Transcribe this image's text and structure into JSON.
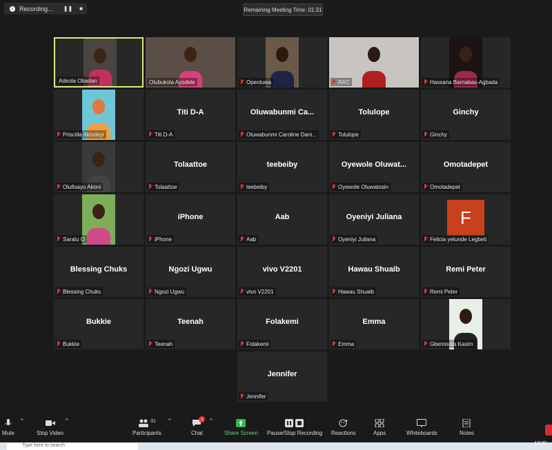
{
  "recording": {
    "label": "Recording...",
    "pause": "❚❚",
    "stop": "■"
  },
  "meeting_timer": "Remaining Meeting Time: 01:31",
  "participants": [
    {
      "big": "",
      "name": "Adeola Obadan",
      "video": true,
      "active": true,
      "bg": "#4a4540",
      "face": "#3a2418",
      "shirt": "#c03060"
    },
    {
      "big": "",
      "name": "Olubukola Ayodele",
      "video": true,
      "bg": "#5a4e47",
      "face": "#3b2415",
      "shirt": "#d8407a"
    },
    {
      "big": "",
      "name": "Opeoluwa",
      "video": true,
      "bg": "#6b5a4a",
      "face": "#2b1a10",
      "shirt": "#224"
    },
    {
      "big": "",
      "name": "RAC",
      "video": true,
      "bg": "#c8c5c0",
      "face": "#2a1a10",
      "shirt": "#b02020"
    },
    {
      "big": "",
      "name": "Hassana Barnabas-Agbada",
      "video": true,
      "bg": "#1c1414",
      "face": "#3a2016",
      "shirt": "#a0284a"
    },
    {
      "big": "",
      "name": "Priscilla Akindeyi",
      "video": true,
      "bg": "#6fc6d6",
      "face": "#e07a3a",
      "shirt": "#f0a040"
    },
    {
      "big": "Titi D-A",
      "name": "Titi D-A"
    },
    {
      "big": "Oluwabunmi  Ca...",
      "name": "Oluwabunmi Caroline Dani..."
    },
    {
      "big": "Tolulope",
      "name": "Tolulope"
    },
    {
      "big": "Ginchy",
      "name": "Ginchy"
    },
    {
      "big": "",
      "name": "Olufisayo Akoni",
      "video": true,
      "bg": "#3a3a3a",
      "face": "#3b2417",
      "shirt": "#444"
    },
    {
      "big": "Tolaattoe",
      "name": "Tolaattoe"
    },
    {
      "big": "teebeiby",
      "name": "teebeiby"
    },
    {
      "big": "Oyewole  Oluwat...",
      "name": "Oyewole Oluwatosin"
    },
    {
      "big": "Omotadepet",
      "name": "Omotadepet"
    },
    {
      "big": "",
      "name": "Saratu O",
      "video": true,
      "bg": "#7fae5a",
      "face": "#3b2416",
      "shirt": "#d04a8a"
    },
    {
      "big": "iPhone",
      "name": "iPhone"
    },
    {
      "big": "Aab",
      "name": "Aab"
    },
    {
      "big": "Oyeniyi Juliana",
      "name": "Oyeniyi Juliana"
    },
    {
      "big": "",
      "name": "Felicia yetunde Legbeti",
      "avatar": "F"
    },
    {
      "big": "Blessing Chuks",
      "name": "Blessing Chuks"
    },
    {
      "big": "Ngozi Ugwu",
      "name": "Ngozi Ugwu"
    },
    {
      "big": "vivo V2201",
      "name": "vivo V2201"
    },
    {
      "big": "Hawau Shuaib",
      "name": "Hawau Shuaib"
    },
    {
      "big": "Remi Peter",
      "name": "Remi Peter"
    },
    {
      "big": "Bukkie",
      "name": "Bukkie"
    },
    {
      "big": "Teenah",
      "name": "Teenah"
    },
    {
      "big": "Folakemi",
      "name": "Folakemi"
    },
    {
      "big": "Emma",
      "name": "Emma"
    },
    {
      "big": "",
      "name": "Gbemisola Kasim",
      "video": true,
      "bg": "#e8efe8",
      "face": "#2e1c12",
      "shirt": "#222"
    },
    {
      "big": "Jennifer",
      "name": "Jennifer"
    }
  ],
  "toolbar": {
    "mute": "Mute",
    "stop_video": "Stop Video",
    "participants": "Participants",
    "participants_count": "31",
    "chat": "Chat",
    "chat_badge": "1",
    "share_screen": "Share Screen",
    "pause_recording": "Pause/Stop Recording",
    "reactions": "Reactions",
    "apps": "Apps",
    "whiteboards": "Whiteboards",
    "notes": "Notes"
  },
  "taskbar": {
    "search_placeholder": "Type here to search",
    "clock": "13:30"
  }
}
